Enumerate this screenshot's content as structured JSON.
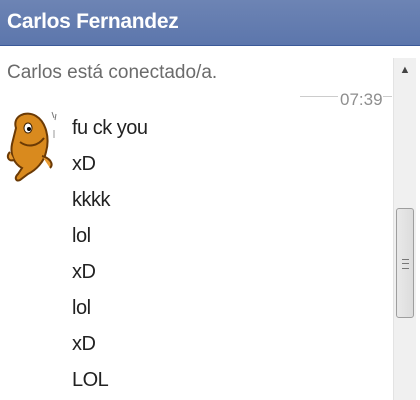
{
  "chat": {
    "contact_name": "Carlos Fernandez",
    "status": "Carlos está conectado/a.",
    "timestamp": "07:39",
    "avatar_icon": "cartoon-creature-avatar",
    "messages": [
      "fu ck you",
      "xD",
      "kkkk",
      "lol",
      "xD",
      "lol",
      "xD",
      "LOL"
    ]
  },
  "scrollbar": {
    "up_icon": "scroll-up-arrow-icon",
    "thumb_icon": "scroll-grip-icon"
  },
  "colors": {
    "titlebar": "#6d84b4",
    "title_text": "#ffffff",
    "status_text": "#6b6b6b",
    "message_text": "#222222"
  }
}
